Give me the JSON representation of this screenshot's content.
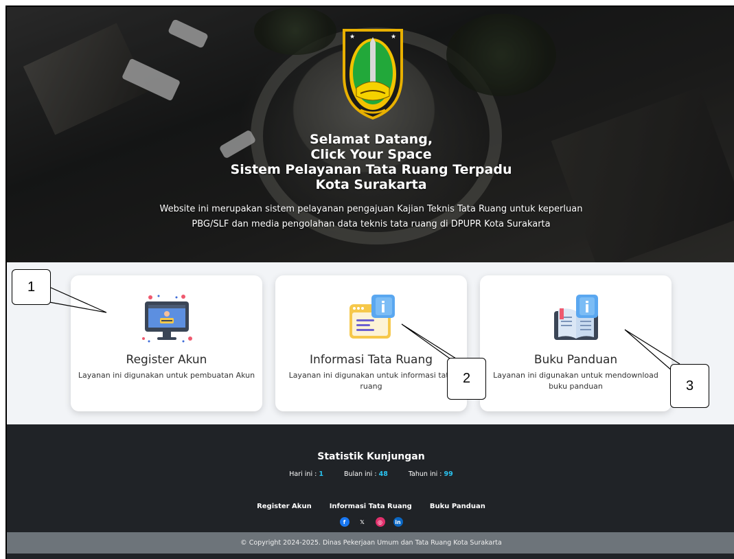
{
  "hero": {
    "title_lines": [
      "Selamat Datang,",
      "Click Your Space",
      "Sistem Pelayanan Tata Ruang Terpadu",
      "Kota Surakarta"
    ],
    "description": "Website ini merupakan sistem pelayanan pengajuan Kajian Teknis Tata Ruang untuk keperluan PBG/SLF dan media pengolahan data teknis tata ruang di DPUPR Kota Surakarta",
    "logo_icon": "city-crest-icon"
  },
  "cards": [
    {
      "title": "Register Akun",
      "description": "Layanan ini digunakan untuk pembuatan Akun",
      "icon": "monitor-icon"
    },
    {
      "title": "Informasi Tata Ruang",
      "description": "Layanan ini digunakan untuk informasi tata ruang",
      "icon": "info-document-icon"
    },
    {
      "title": "Buku Panduan",
      "description": "Layanan ini digunakan untuk mendownload buku panduan",
      "icon": "info-book-icon"
    }
  ],
  "callouts": [
    "1",
    "2",
    "3"
  ],
  "footer": {
    "stat_title": "Statistik Kunjungan",
    "stats": [
      {
        "label": "Hari ini :",
        "value": "1"
      },
      {
        "label": "Bulan ini :",
        "value": "48"
      },
      {
        "label": "Tahun ini :",
        "value": "99"
      }
    ],
    "links": [
      "Register Akun",
      "Informasi Tata Ruang",
      "Buku Panduan"
    ],
    "social": [
      {
        "icon": "facebook-icon",
        "glyph": "f",
        "color": "#1877f2"
      },
      {
        "icon": "x-icon",
        "glyph": "𝕏",
        "color": "#202327"
      },
      {
        "icon": "instagram-icon",
        "glyph": "◎",
        "color": "#e1306c"
      },
      {
        "icon": "linkedin-icon",
        "glyph": "in",
        "color": "#0a66c2"
      }
    ],
    "copyright": "© Copyright 2024-2025. Dinas Pekerjaan Umum dan Tata Ruang Kota Surakarta"
  },
  "colors": {
    "stat_value": "#29c3f0",
    "footer_bg": "#202327",
    "copyright_bg": "#6d747a"
  }
}
